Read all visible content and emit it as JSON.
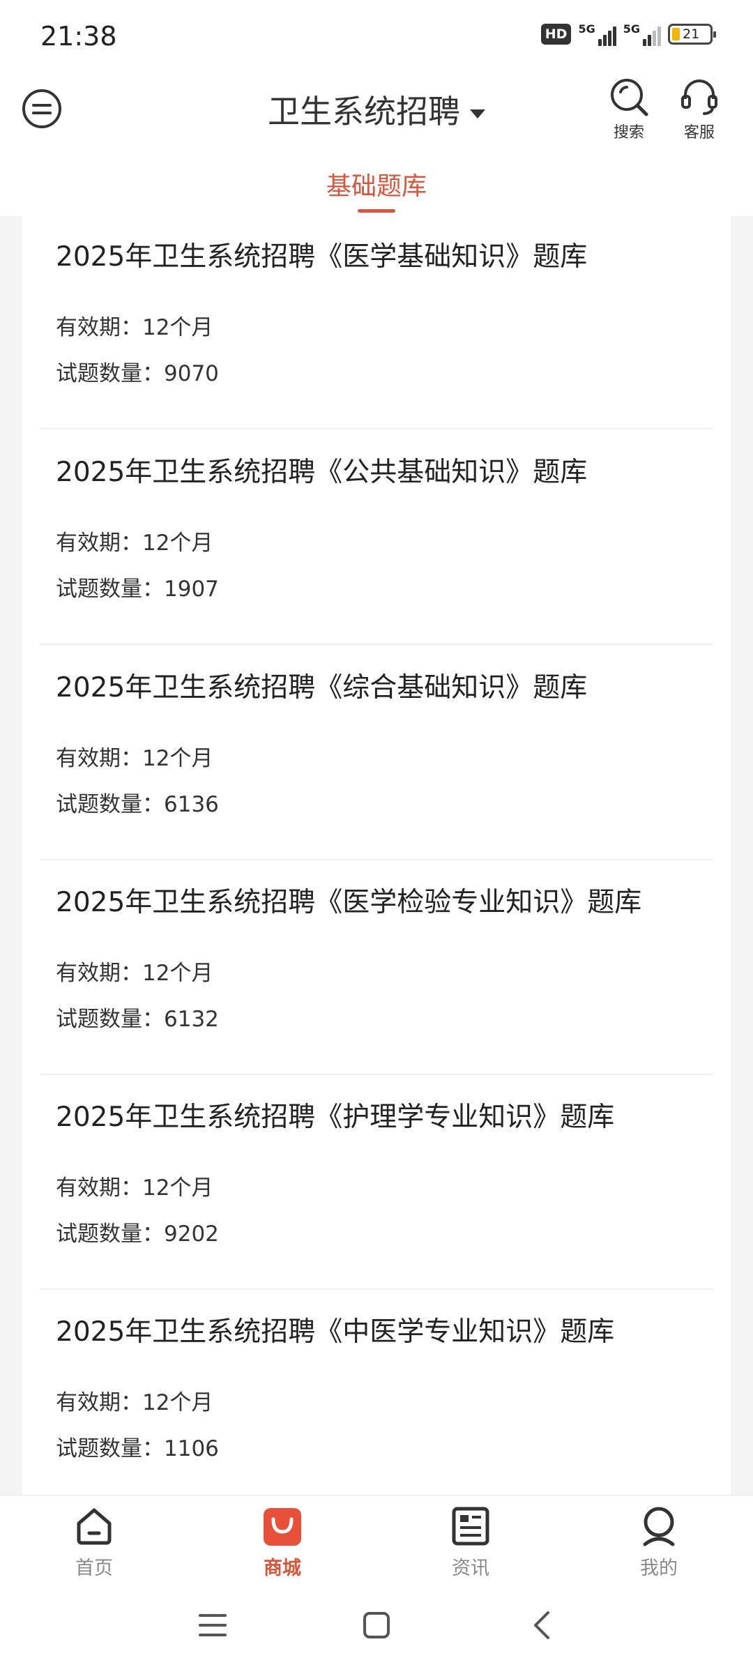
{
  "status_bar": {
    "time": "21:38",
    "hd_badge": "HD",
    "network_1": "5G",
    "network_2": "5G",
    "battery_level": "21"
  },
  "header": {
    "title": "卫生系统招聘",
    "search_label": "搜索",
    "service_label": "客服"
  },
  "tabs": {
    "active": "基础题库"
  },
  "items": [
    {
      "title": "2025年卫生系统招聘《医学基础知识》题库",
      "validity": "有效期：12个月",
      "count": "试题数量：9070"
    },
    {
      "title": "2025年卫生系统招聘《公共基础知识》题库",
      "validity": "有效期：12个月",
      "count": "试题数量：1907"
    },
    {
      "title": "2025年卫生系统招聘《综合基础知识》题库",
      "validity": "有效期：12个月",
      "count": "试题数量：6136"
    },
    {
      "title": "2025年卫生系统招聘《医学检验专业知识》题库",
      "validity": "有效期：12个月",
      "count": "试题数量：6132"
    },
    {
      "title": "2025年卫生系统招聘《护理学专业知识》题库",
      "validity": "有效期：12个月",
      "count": "试题数量：9202"
    },
    {
      "title": "2025年卫生系统招聘《中医学专业知识》题库",
      "validity": "有效期：12个月",
      "count": "试题数量：1106"
    }
  ],
  "bottom_nav": {
    "home": "首页",
    "mall": "商城",
    "news": "资讯",
    "mine": "我的",
    "active": "mall"
  },
  "colors": {
    "accent": "#d8563c",
    "text": "#222222",
    "muted": "#888888",
    "background": "#f4f4f4"
  }
}
